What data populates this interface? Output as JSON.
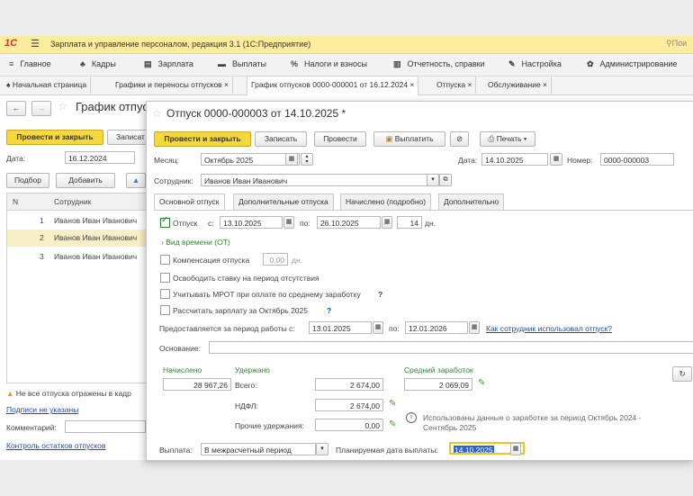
{
  "app": {
    "logo": "1С",
    "title": "Зарплата и управление персоналом, редакция 3.1  (1С:Предприятие)",
    "search_placeholder": "Пои"
  },
  "menu": [
    {
      "icon": "≡",
      "label": "Главное"
    },
    {
      "icon": "♣",
      "label": "Кадры"
    },
    {
      "icon": "▤",
      "label": "Зарплата"
    },
    {
      "icon": "▬",
      "label": "Выплаты"
    },
    {
      "icon": "%",
      "label": "Налоги и взносы"
    },
    {
      "icon": "▥",
      "label": "Отчетность, справки"
    },
    {
      "icon": "✎",
      "label": "Настройка"
    },
    {
      "icon": "✿",
      "label": "Администрирование"
    }
  ],
  "tabs": [
    {
      "label": "Начальная страница"
    },
    {
      "label": "Графики и переносы отпусков ×"
    },
    {
      "label": "График отпусков 0000-000001 от 16.12.2024 ×"
    },
    {
      "label": "Отпуска ×"
    },
    {
      "label": "Обслуживание ×"
    }
  ],
  "bg": {
    "title": "График отпус",
    "post_close": "Провести и закрыть",
    "record": "Записат",
    "date_label": "Дата:",
    "date_value": "16.12.2024",
    "pick": "Подбор",
    "add": "Добавить",
    "table_headers": [
      "N",
      "Сотрудник"
    ],
    "rows": [
      {
        "n": "1",
        "name": "Иванов Иван Иванович"
      },
      {
        "n": "2",
        "name": "Иванов Иван Иванович"
      },
      {
        "n": "3",
        "name": "Иванов Иван Иванович"
      }
    ],
    "warning": "Не все отпуска отражены в кадр",
    "signatures": "Подписи не указаны",
    "comment_label": "Комментарий:",
    "control_link": "Контроль остатков отпусков"
  },
  "modal": {
    "title": "Отпуск 0000-000003 от 14.10.2025 *",
    "post_close": "Провести и закрыть",
    "record": "Записать",
    "post": "Провести",
    "pay": "Выплатить",
    "print": "Печать",
    "month_label": "Месяц:",
    "month_value": "Октябрь 2025",
    "date_label": "Дата:",
    "date_value": "14.10.2025",
    "number_label": "Номер:",
    "number_value": "0000-000003",
    "employee_label": "Сотрудник:",
    "employee_value": "Иванов Иван Иванович",
    "form_tabs": [
      "Основной отпуск",
      "Дополнительные отпуска",
      "Начислено (подробно)",
      "Дополнительно"
    ],
    "vacation_label": "Отпуск",
    "from_label": "с:",
    "from_value": "13.10.2025",
    "to_label": "по:",
    "to_value": "26.10.2025",
    "days_value": "14",
    "days_unit": "дн.",
    "time_kind": "Вид времени (ОТ)",
    "compensation_label": "Компенсация отпуска",
    "compensation_value": "0,00",
    "compensation_unit": "дн.",
    "release_rate": "Освободить ставку на период отсутствия",
    "mrot": "Учитывать МРОТ при оплате по среднему заработку",
    "calc_salary": "Рассчитать зарплату за Октябрь 2025",
    "help_mark": "?",
    "period_label": "Предоставляется за период работы с:",
    "period_from": "13.01.2025",
    "period_to_label": "по:",
    "period_to": "12.01.2026",
    "period_link": "Как сотрудник использовал отпуск?",
    "basis_label": "Основание:",
    "accrued_label": "Начислено",
    "withheld_label": "Удержано",
    "avg_label": "Средний заработок",
    "accrued_value": "28 967,26",
    "total_label": "Всего:",
    "total_value": "2 674,00",
    "avg_value": "2 069,09",
    "ndfl_label": "НДФЛ:",
    "ndfl_value": "2 674,00",
    "other_label": "Прочие удержания:",
    "other_value": "0,00",
    "info_text_1": "Использованы данные о заработке за период Октябрь 2024 -",
    "info_text_2": "Сентябрь 2025",
    "payout_label": "Выплата:",
    "payout_value": "В межрасчетный период",
    "planned_label": "Планируемая дата выплаты:",
    "planned_value": "14.10.2025"
  }
}
